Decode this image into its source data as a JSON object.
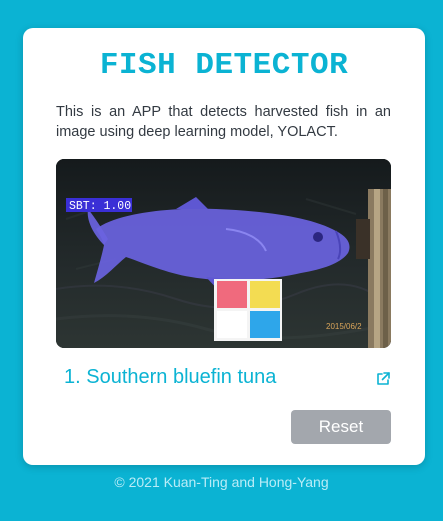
{
  "app": {
    "title": "FISH DETECTOR",
    "description": "This is an APP that detects harvested fish in an image using deep learning model, YOLACT."
  },
  "detection_image": {
    "box_label": "SBT: 1.00",
    "timestamp": "2015/06/2"
  },
  "results": [
    {
      "label": "1. Southern bluefin tuna",
      "icon": "external-link-icon"
    }
  ],
  "actions": {
    "reset_label": "Reset"
  },
  "footer": {
    "text": "© 2021 Kuan-Ting and Hong-Yang"
  },
  "colors": {
    "background": "#0bb3d3",
    "accent": "#0bb3d3",
    "card": "#ffffff",
    "button": "#a3a7ad",
    "mask": "#6a63e0"
  }
}
